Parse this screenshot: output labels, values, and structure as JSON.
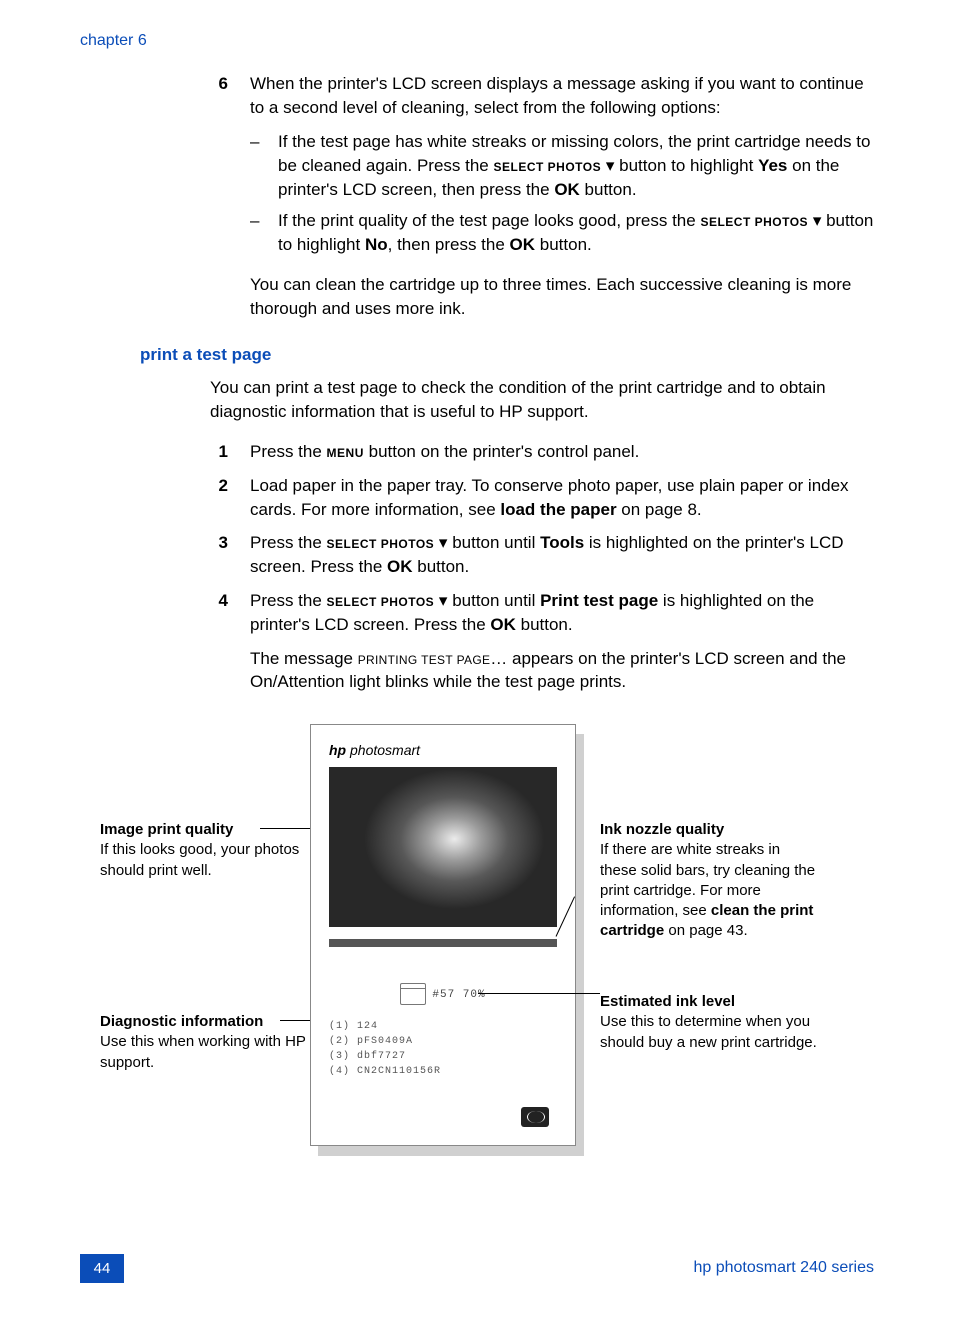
{
  "chapter": "chapter 6",
  "step6": {
    "num": "6",
    "text_a": "When the printer's LCD screen displays a message asking if you want to continue to a second level of cleaning, select from the following options:",
    "bullet1_a": "If the test page has white streaks or missing colors, the print cartridge needs to be cleaned again. Press the ",
    "select_photos": "Select Photos",
    "bullet1_b": " button to highlight ",
    "yes": "Yes",
    "bullet1_c": " on the printer's LCD screen, then press the ",
    "ok": "OK",
    "bullet1_d": " button.",
    "bullet2_a": "If the print quality of the test page looks good, press the ",
    "bullet2_b": " button to highlight ",
    "no": "No",
    "bullet2_c": ", then press the ",
    "bullet2_d": " button.",
    "tail": "You can clean the cartridge up to three times. Each successive cleaning is more thorough and uses more ink."
  },
  "section_heading": "print a test page",
  "intro": "You can print a test page to check the condition of the print cartridge and to obtain diagnostic information that is useful to HP support.",
  "steps": {
    "s1": {
      "num": "1",
      "a": "Press the ",
      "menu": "Menu",
      "b": " button on the printer's control panel."
    },
    "s2": {
      "num": "2",
      "a": "Load paper in the paper tray. To conserve photo paper, use plain paper or index cards. For more information, see ",
      "load": "load the paper",
      "b": " on page 8."
    },
    "s3": {
      "num": "3",
      "a": "Press the ",
      "b": " button until ",
      "tools": "Tools",
      "c": " is highlighted on the printer's LCD screen. Press the ",
      "d": " button."
    },
    "s4": {
      "num": "4",
      "a": "Press the ",
      "b": " button until ",
      "ptp": "Print test page",
      "c": " is highlighted on the printer's LCD screen. Press the ",
      "d": " button."
    }
  },
  "result_a": "The message ",
  "result_msg": "Printing test page",
  "result_b": "… appears on the printer's LCD screen and the On/Attention light blinks while the test page prints.",
  "callouts": {
    "imgq_title": "Image print quality",
    "imgq_body": "If this looks good, your photos should print well.",
    "diag_title": "Diagnostic information",
    "diag_body": "Use this when working with HP support.",
    "ink_title": "Ink nozzle quality",
    "ink_body_a": "If there are white streaks in these solid bars, try cleaning the print cartridge. For more information, see ",
    "ink_body_bold": "clean the print cartridge",
    "ink_body_b": " on page 43.",
    "est_title": "Estimated ink level",
    "est_body": "Use this to determine when you should buy a new print cartridge."
  },
  "testpage": {
    "brand_a": "hp",
    "brand_b": " photosmart",
    "cart": "#57  70%",
    "diag1": "(1) 124",
    "diag2": "(2) pFS0409A",
    "diag3": "(3) dbf7727",
    "diag4": "(4) CN2CN110156R"
  },
  "footer": {
    "page": "44",
    "series": "hp photosmart 240 series"
  }
}
